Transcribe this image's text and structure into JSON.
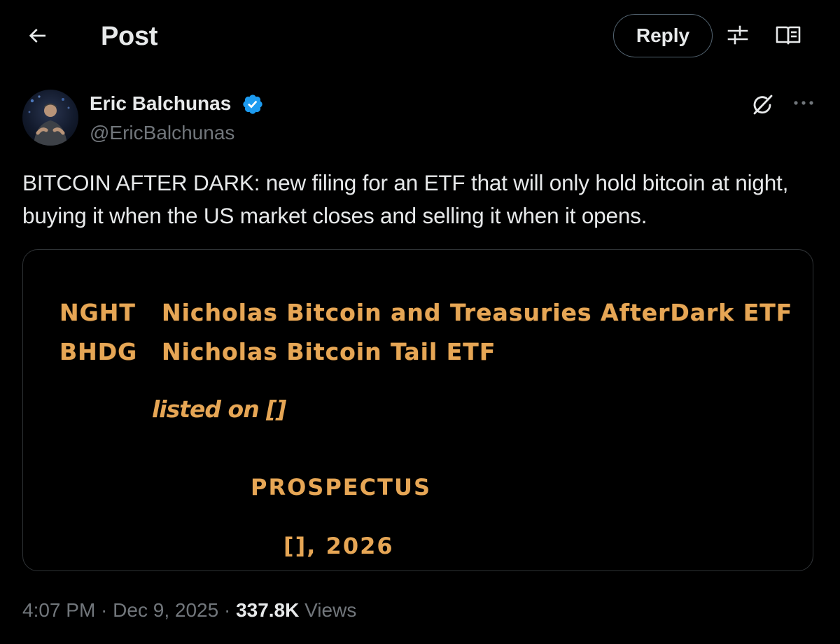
{
  "header": {
    "title": "Post",
    "reply_label": "Reply",
    "back_icon": "arrow-left-icon",
    "filter_icon": "sliders-icon",
    "reader_icon": "book-open-icon"
  },
  "author": {
    "name": "Eric Balchunas",
    "handle": "@EricBalchunas",
    "verified": true,
    "badge_color": "#1d9bf0"
  },
  "tweet": {
    "text": "BITCOIN AFTER DARK: new filing for an ETF that will only hold bitcoin at night, buying it when the US market closes and selling it when it opens."
  },
  "media": {
    "rows": [
      {
        "ticker": "NGHT",
        "name": "Nicholas Bitcoin and Treasuries AfterDark ETF"
      },
      {
        "ticker": "BHDG",
        "name": "Nicholas Bitcoin Tail ETF"
      }
    ],
    "listed_on": "listed on []",
    "prospectus": "PROSPECTUS",
    "date": "[], 2026",
    "text_color": "#e6a655"
  },
  "meta": {
    "time": "4:07 PM",
    "separator": " · ",
    "date": "Dec 9, 2025",
    "views_count": "337.8K",
    "views_label": "Views"
  },
  "colors": {
    "background": "#000000",
    "text_primary": "#e7e9ea",
    "text_secondary": "#71767b",
    "border": "#2f3336"
  }
}
